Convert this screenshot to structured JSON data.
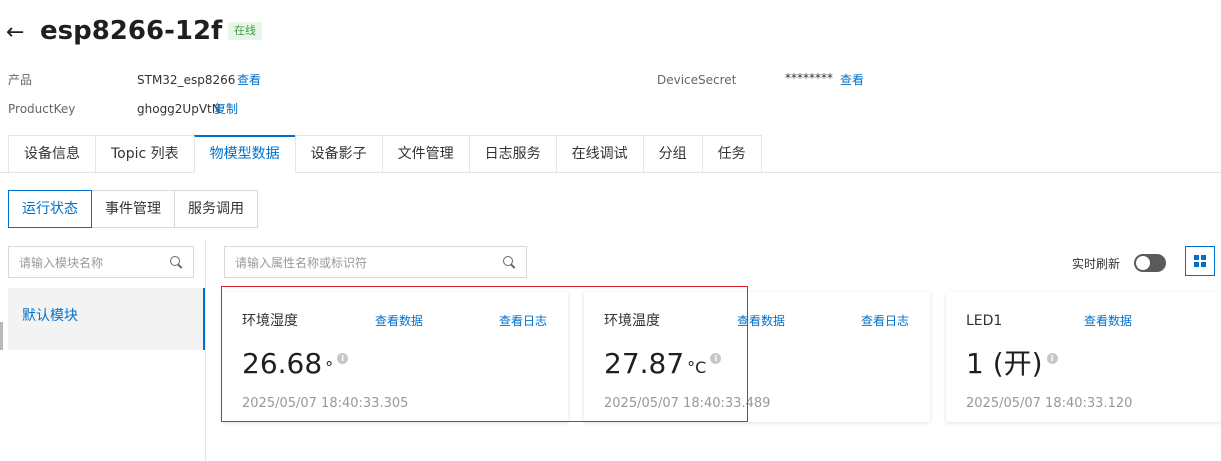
{
  "header": {
    "title": "esp8266-12f",
    "status": "在线"
  },
  "info": {
    "product_label": "产品",
    "product_value": "STM32_esp8266",
    "product_link": "查看",
    "productkey_label": "ProductKey",
    "productkey_value": "ghogg2UpVtN",
    "productkey_link": "复制",
    "secret_label": "DeviceSecret",
    "secret_value": "********",
    "secret_link": "查看"
  },
  "main_tabs": [
    "设备信息",
    "Topic 列表",
    "物模型数据",
    "设备影子",
    "文件管理",
    "日志服务",
    "在线调试",
    "分组",
    "任务"
  ],
  "main_tab_active": "物模型数据",
  "sub_tabs": [
    "运行状态",
    "事件管理",
    "服务调用"
  ],
  "sub_tab_active": "运行状态",
  "module_search": {
    "placeholder": "请输入模块名称"
  },
  "property_search": {
    "placeholder": "请输入属性名称或标识符"
  },
  "modules": [
    "默认模块"
  ],
  "realtime_refresh": {
    "label": "实时刷新",
    "enabled": false
  },
  "cards": [
    {
      "title": "环境湿度",
      "link_data": "查看数据",
      "link_log": "查看日志",
      "value": "26.68",
      "unit": "°",
      "time": "2025/05/07 18:40:33.305"
    },
    {
      "title": "环境温度",
      "link_data": "查看数据",
      "link_log": "查看日志",
      "value": "27.87",
      "unit": "°C",
      "time": "2025/05/07 18:40:33.489"
    },
    {
      "title": "LED1",
      "link_data": "查看数据",
      "value": "1 (开)",
      "unit": "",
      "time": "2025/05/07 18:40:33.120"
    }
  ],
  "colors": {
    "accent": "#0070cc",
    "online": "#3c9b3c",
    "highlight": "#d9232d"
  }
}
